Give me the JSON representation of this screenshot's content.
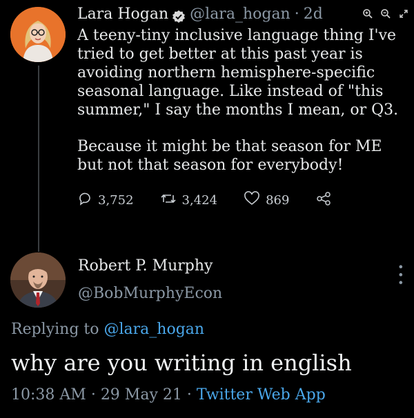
{
  "tweet": {
    "author_name": "Lara Hogan",
    "author_handle": "@lara_hogan",
    "separator": "·",
    "age": "2d",
    "paragraphs": [
      "A teeny-tiny inclusive language thing I've tried to get better at this past year is avoiding northern hemisphere-specific seasonal language. Like instead of \"this summer,\" I say the months I mean, or Q3.",
      "Because it might be that season for ME but not that season for everybody!"
    ],
    "replies": "3,752",
    "retweets": "3,424",
    "likes": "869"
  },
  "reply": {
    "author_name": "Robert P. Murphy",
    "author_handle": "@BobMurphyEcon",
    "replying_prefix": "Replying to",
    "replying_to": "@lara_hogan",
    "text": "why are you writing in english",
    "time": "10:38 AM",
    "sep1": "·",
    "date": "29 May 21",
    "sep2": "·",
    "app": "Twitter Web App"
  },
  "icons": [
    "verified-badge-icon",
    "zoom-in-icon",
    "zoom-out-icon",
    "expand-icon",
    "reply-icon",
    "retweet-icon",
    "like-icon",
    "share-icon",
    "more-icon"
  ],
  "colors": {
    "background": "#000000",
    "link": "#4aa7ea",
    "muted": "#8b98a5",
    "avatar1_bg": "#e8732b"
  }
}
